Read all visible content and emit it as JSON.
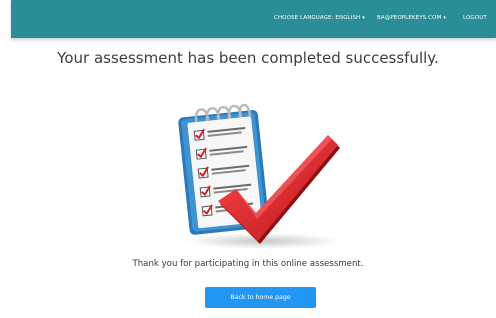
{
  "navbar": {
    "language_label": "CHOOSE LANGUAGE: ENGLISH",
    "account_label": "BA@PEOPLEKEYS.COM",
    "logout_label": "LOGOUT",
    "caret": "▾"
  },
  "main": {
    "heading": "Your assessment has been completed successfully.",
    "illustration_icon": "checklist-clipboard-checkmark-icon",
    "thank_you": "Thank you for participating in this online assessment.",
    "home_button_label": "Back to home page"
  },
  "colors": {
    "navbar": "#2a8d97",
    "button": "#2196f3",
    "check": "#e2242b"
  }
}
